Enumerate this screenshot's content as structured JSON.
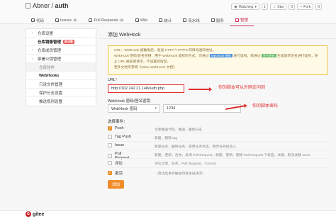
{
  "repo": {
    "owner": "Abner",
    "sep": " / ",
    "name": "auth"
  },
  "header_actions": {
    "watching_label": "Watching",
    "watching_count": "1",
    "star_label": "Star",
    "star_count": "0",
    "fork_label": "Fork",
    "fork_count": "0"
  },
  "tabs": [
    {
      "label": "代码",
      "icon": "code-icon"
    },
    {
      "label": "Issues",
      "badge": "0",
      "icon": "issues-icon"
    },
    {
      "label": "Pull Requests",
      "badge": "0",
      "icon": "pr-icon"
    },
    {
      "label": "Wiki",
      "icon": "wiki-icon"
    },
    {
      "label": "统计",
      "icon": "stats-icon"
    },
    {
      "label": "流水线",
      "icon": "pipeline-icon"
    },
    {
      "label": "服务",
      "icon": "service-icon"
    },
    {
      "label": "管理",
      "icon": "settings-icon",
      "active": true
    }
  ],
  "sidebar": {
    "items": [
      {
        "label": "仓库设置",
        "caret": "›"
      },
      {
        "label": "仓库镜像管理",
        "badge": "新功能"
      },
      {
        "label": "仓库成员管理",
        "caret": "›"
      },
      {
        "label": "部署公钥管理",
        "caret": "›"
      },
      {
        "label": "仓库挂件",
        "group": true
      },
      {
        "label": "WebHooks",
        "active": true
      },
      {
        "label": "只读文件管理"
      },
      {
        "label": "保护分支设置"
      },
      {
        "label": "推送规则设置"
      }
    ]
  },
  "page_title": "添加 WebHook",
  "notice": {
    "line1": "URL：WebHook 被触发后，发送 HTTP / HTTPS 的目标通知地址。",
    "line2a": "WebHook 密码/签名密钥：用于 WebHook 鉴权的方式，可通过",
    "tag1": "WebHook 密码",
    "line2b": "进行鉴权，或通过",
    "tag2": "签名密钥",
    "line2c": "生成请求签名进行鉴权，防止 URL 被恶意请求，不设置则留空。",
    "line3": "更多文档可参阅《Gitee WebHook 文档》"
  },
  "form": {
    "url_label": "URL",
    "url_required": "*",
    "url_value": "http://102.242.21.148/auth.php",
    "secret_label": "WebHook 密码/签名密钥",
    "secret_type": "WebHook 密码",
    "secret_value": "1234",
    "events_label": "选择事件："
  },
  "annotations": {
    "url_note": "你的脚本可以外网访问到",
    "secret_note": "你的脚本密码"
  },
  "events": [
    {
      "name": "Push",
      "checked": true,
      "desc": "仓库推送代码、推送、删除分支"
    },
    {
      "name": "Tag Push",
      "checked": false,
      "desc": "新建、删除 tag"
    },
    {
      "name": "Issue",
      "checked": false,
      "desc": "新建任务、删除任务、变更任务状态、更改任务指派人"
    },
    {
      "name": "Pull Request",
      "checked": false,
      "desc": "新建、更新、合并、关闭 Pull Request，新建、更新、删除 Pull Request 下标签，关联、取消关联 Issue"
    },
    {
      "name": "评论",
      "checked": false,
      "desc": "评论仓库、任务、Pull Request、Commit"
    }
  ],
  "active": {
    "label": "激活",
    "checked": true,
    "desc": "（激活后事件触发时将发送请求）"
  },
  "add_button": "添加",
  "footer": {
    "logo_text": "gitee",
    "logo_glyph": "G"
  },
  "colors": {
    "accent": "#f08c2a",
    "highlight": "#e03030",
    "brand": "#c71d23"
  }
}
